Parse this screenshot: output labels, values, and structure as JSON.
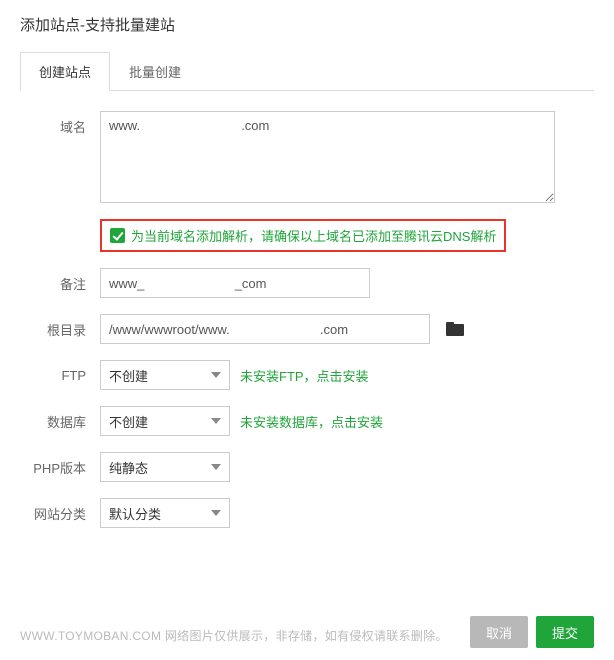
{
  "dialog": {
    "title": "添加站点-支持批量建站"
  },
  "tabs": {
    "create": "创建站点",
    "batch": "批量创建"
  },
  "labels": {
    "domain": "域名",
    "note": "备注",
    "root": "根目录",
    "ftp": "FTP",
    "db": "数据库",
    "php": "PHP版本",
    "category": "网站分类"
  },
  "fields": {
    "domain_value": "www.                            .com",
    "dns_hint": "为当前域名添加解析，请确保以上域名已添加至腾讯云DNS解析",
    "note_value": "www_                         _com",
    "root_value": "/www/wwwroot/www.                         .com",
    "ftp_select": "不创建",
    "ftp_hint": "未安装FTP，点击安装",
    "db_select": "不创建",
    "db_hint": "未安装数据库，点击安装",
    "php_select": "纯静态",
    "category_select": "默认分类"
  },
  "buttons": {
    "cancel": "取消",
    "submit": "提交"
  },
  "watermark": "WWW.TOYMOBAN.COM   网络图片仅供展示，非存储，如有侵权请联系删除。"
}
